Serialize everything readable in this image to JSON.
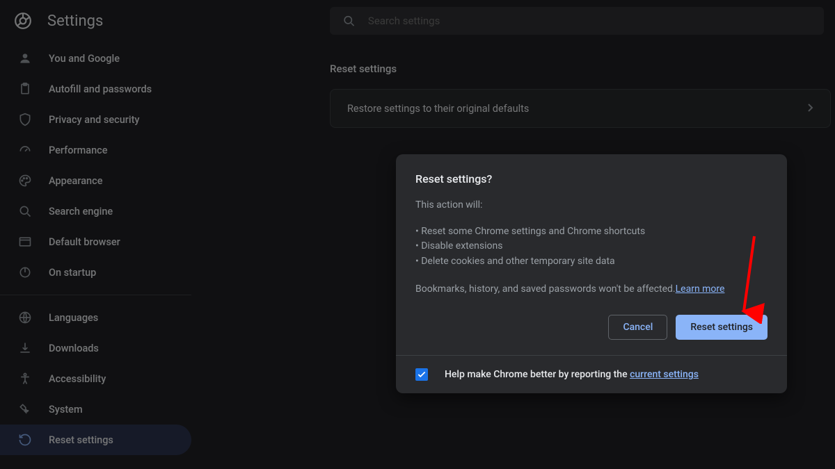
{
  "header": {
    "title": "Settings",
    "search_placeholder": "Search settings"
  },
  "sidebar": {
    "items": [
      {
        "icon": "person-icon",
        "label": "You and Google"
      },
      {
        "icon": "clipboard-icon",
        "label": "Autofill and passwords"
      },
      {
        "icon": "shield-icon",
        "label": "Privacy and security"
      },
      {
        "icon": "speedometer-icon",
        "label": "Performance"
      },
      {
        "icon": "palette-icon",
        "label": "Appearance"
      },
      {
        "icon": "search-icon",
        "label": "Search engine"
      },
      {
        "icon": "browser-icon",
        "label": "Default browser"
      },
      {
        "icon": "power-icon",
        "label": "On startup"
      }
    ],
    "items2": [
      {
        "icon": "globe-icon",
        "label": "Languages"
      },
      {
        "icon": "download-icon",
        "label": "Downloads"
      },
      {
        "icon": "accessibility-icon",
        "label": "Accessibility"
      },
      {
        "icon": "wrench-icon",
        "label": "System"
      },
      {
        "icon": "restore-icon",
        "label": "Reset settings",
        "active": true
      }
    ]
  },
  "content": {
    "section_title": "Reset settings",
    "row_label": "Restore settings to their original defaults"
  },
  "dialog": {
    "title": "Reset settings?",
    "intro": "This action will:",
    "bullets": [
      "Reset some Chrome settings and Chrome shortcuts",
      "Disable extensions",
      "Delete cookies and other temporary site data"
    ],
    "footer_text": "Bookmarks, history, and saved passwords won't be affected.",
    "learn_more": "Learn more",
    "cancel_label": "Cancel",
    "confirm_label": "Reset settings",
    "report_prefix": "Help make Chrome better by reporting the ",
    "report_link": "current settings",
    "report_checked": true
  },
  "annotation": {
    "arrow_color": "#ff0000"
  }
}
